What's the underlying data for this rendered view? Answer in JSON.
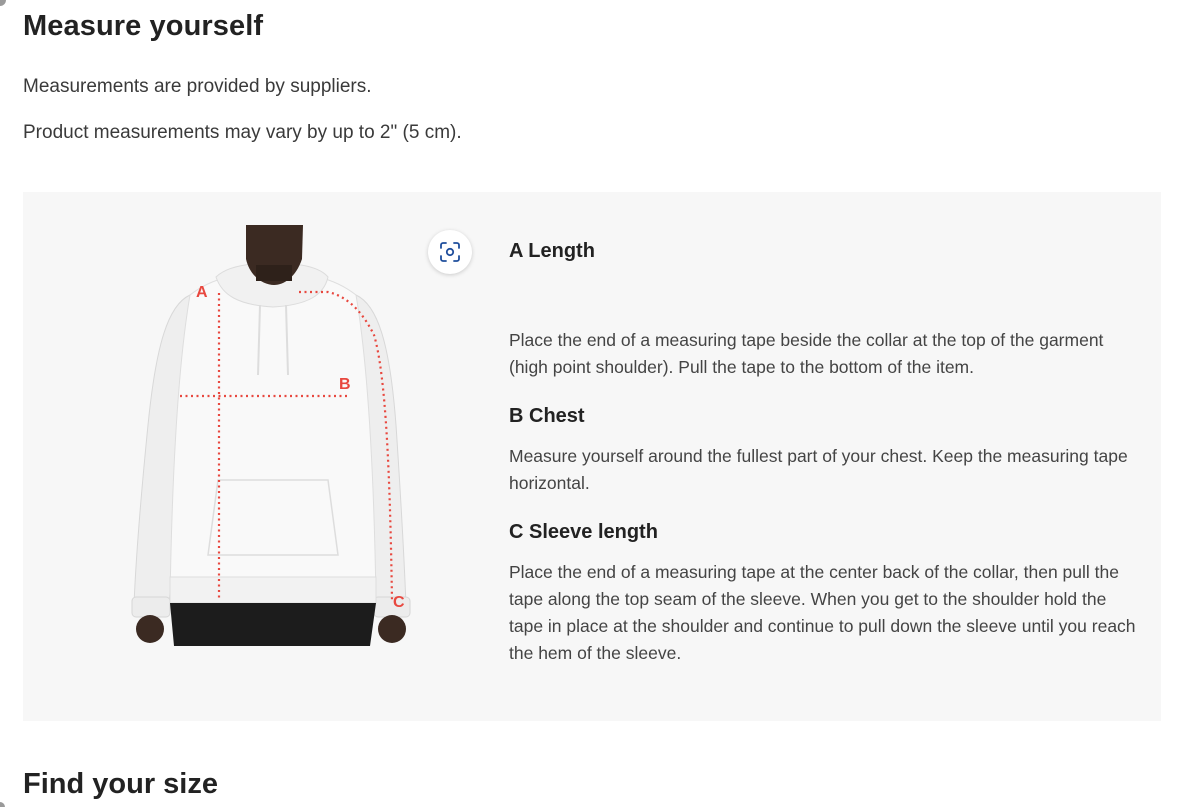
{
  "header": {
    "title": "Measure yourself"
  },
  "notes": [
    "Measurements are provided by suppliers.",
    "Product measurements may vary by up to 2\" (5 cm)."
  ],
  "figure": {
    "markers": {
      "a": "A",
      "b": "B",
      "c": "C"
    },
    "marker_color": "#e8483f",
    "zoom_icon": "zoom-scan-icon"
  },
  "sections": [
    {
      "title": "A Length",
      "description": "Place the end of a measuring tape beside the collar at the top of the garment (high point shoulder). Pull the tape to the bottom of the item."
    },
    {
      "title": "B Chest",
      "description": "Measure yourself around the fullest part of your chest. Keep the measuring tape horizontal."
    },
    {
      "title": "C Sleeve length",
      "description": "Place the end of a measuring tape at the center back of the collar, then pull the tape along the top seam of the sleeve. When you get to the shoulder hold the tape in place at the shoulder and continue to pull down the sleeve until you reach the hem of the sleeve."
    }
  ],
  "footer": {
    "title": "Find your size"
  }
}
